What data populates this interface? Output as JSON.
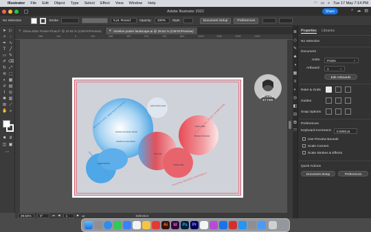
{
  "menubar": {
    "app": "Illustrator",
    "items": [
      "File",
      "Edit",
      "Object",
      "Type",
      "Select",
      "Effect",
      "View",
      "Window",
      "Help"
    ],
    "datetime": "Tue 17 May  7:14 PM"
  },
  "window": {
    "title": "Adobe Illustrator 2022",
    "share_label": "Share"
  },
  "control_bar": {
    "selection": "No Selection",
    "stroke_label": "Stroke",
    "brush_label": "5 pt. Round",
    "opacity_label": "Opacity:",
    "opacity_value": "100%",
    "style_label": "Style:",
    "document_setup": "Document Setup",
    "preferences": "Preferences"
  },
  "tabs": [
    {
      "label": "Elena Etter Poster FinaL2* @ 22.62 % (CMYK/Preview)"
    },
    {
      "label": "timeline poster landscape.ai @ 29.64 % (CMYK/Preview)"
    }
  ],
  "ruler_ticks": [
    "288",
    "144",
    "0",
    "144",
    "288",
    "432",
    "576",
    "720",
    "864",
    "1008",
    "1152",
    "1296",
    "1440"
  ],
  "poster": {
    "arc_texts": [
      "BEGAN FLUTE, NEW HIGH SCHOOL",
      "FRENCH HORN, STUDY IN MEDICINE",
      "BORN 1961 · BEGAN PIANO",
      "STARTED RHODES UNIVERSITY"
    ],
    "notes": [
      "early school years",
      "boarder at primary school",
      "transfer to new school",
      "began lessons",
      "matric finals",
      "Rhodes University",
      "first year",
      "college days"
    ],
    "badge_text": "ELENA ETTER"
  },
  "status": {
    "zoom": "29.64%",
    "angle": "0°",
    "page": "1",
    "tool": "Selection"
  },
  "properties": {
    "tabs": [
      "Properties",
      "Libraries"
    ],
    "no_selection": "No Selection",
    "document_heading": "Document",
    "units_label": "Units:",
    "units_value": "Points",
    "artboard_label": "Artboard:",
    "artboard_value": "1",
    "edit_artboards": "Edit Artboards",
    "ruler_grids": "Ruler & Grids",
    "guides": "Guides",
    "snap_options": "Snap Options",
    "preferences_heading": "Preferences",
    "keyboard_increment_label": "Keyboard Increment:",
    "keyboard_increment_value": "0.0283 pt",
    "use_preview_bounds": "Use Preview Bounds",
    "scale_corners": "Scale Corners",
    "scale_strokes": "Scale Strokes & Effects",
    "quick_actions": "Quick Actions",
    "document_setup_btn": "Document Setup",
    "preferences_btn": "Preferences"
  },
  "colors": {
    "blue_gradient": "#4aa8e8",
    "red_gradient": "#e8606a",
    "accent": "#1473e6"
  }
}
